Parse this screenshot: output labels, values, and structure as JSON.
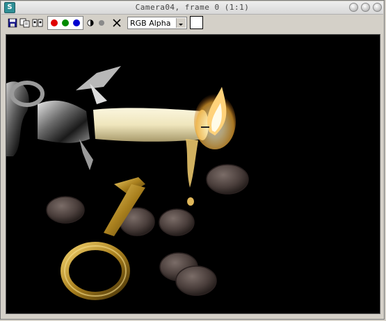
{
  "window": {
    "title": "Camera04, frame 0 (1:1)",
    "app_icon": "3ds-max-icon"
  },
  "toolbar": {
    "icons": [
      "save-icon",
      "copy-icon",
      "clone-icon",
      "red-channel-icon",
      "green-channel-icon",
      "blue-channel-icon",
      "monochrome-icon",
      "alpha-icon",
      "clear-icon"
    ],
    "channel_select": "RGB Alpha",
    "swatch_color": "#ffffff",
    "channel_colors": {
      "red": "#e00000",
      "green": "#008a00",
      "blue": "#0000d0"
    }
  },
  "render": {
    "description_colors": {
      "background": "#000000",
      "candle": "#efe8c4",
      "flame": "#ffd27a",
      "brass": "#c79a2c"
    }
  }
}
